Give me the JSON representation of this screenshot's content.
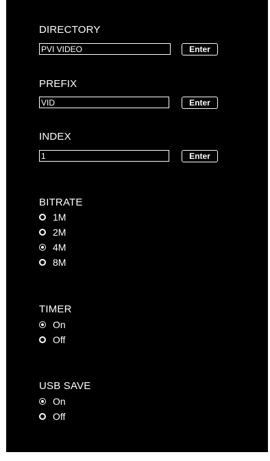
{
  "directory": {
    "label": "DIRECTORY",
    "value": "PVI VIDEO",
    "button_label": "Enter"
  },
  "prefix": {
    "label": "PREFIX",
    "value": "VID",
    "button_label": "Enter"
  },
  "index": {
    "label": "INDEX",
    "value": "1",
    "button_label": "Enter"
  },
  "bitrate": {
    "label": "BITRATE",
    "options": [
      "1M",
      "2M",
      "4M",
      "8M"
    ],
    "selected": "4M"
  },
  "timer": {
    "label": "TIMER",
    "options": [
      "On",
      "Off"
    ],
    "selected": "On"
  },
  "usb_save": {
    "label": "USB SAVE",
    "options": [
      "On",
      "Off"
    ],
    "selected": "On"
  },
  "colors": {
    "background": "#000000",
    "foreground": "#ffffff"
  }
}
